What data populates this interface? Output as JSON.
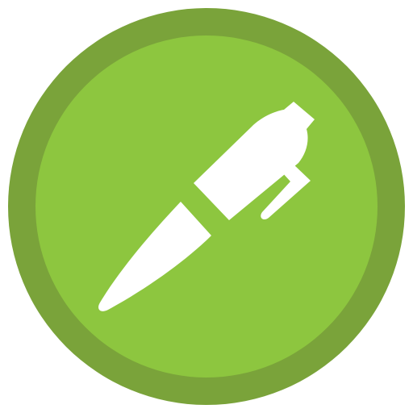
{
  "icon": {
    "name": "pen-icon",
    "colors": {
      "outer_ring": "#7aa33a",
      "inner_circle": "#8dc63f",
      "glyph": "#ffffff"
    }
  }
}
